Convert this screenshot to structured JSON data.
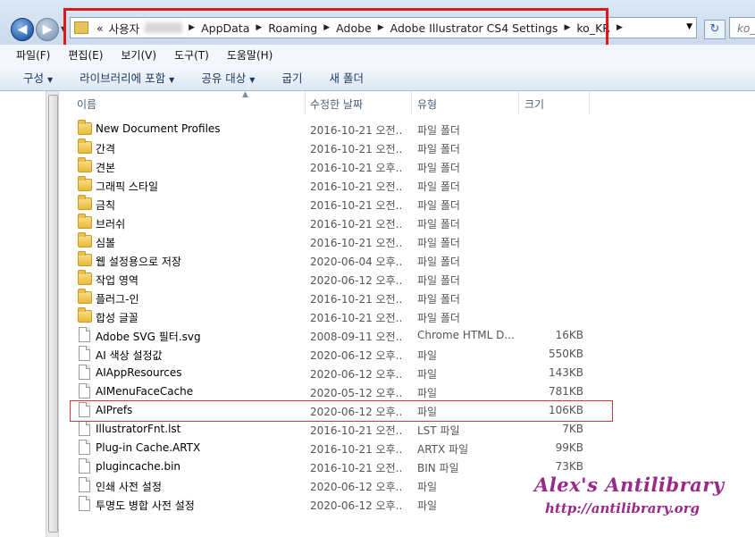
{
  "address_bar": {
    "overflow_marker": "«",
    "segments": [
      "사용자",
      "AppData",
      "Roaming",
      "Adobe",
      "Adobe Illustrator CS4 Settings",
      "ko_KR"
    ],
    "search_placeholder": "ko_"
  },
  "menu": [
    "파일(F)",
    "편집(E)",
    "보기(V)",
    "도구(T)",
    "도움말(H)"
  ],
  "commands": [
    {
      "label": "구성",
      "dropdown": true
    },
    {
      "label": "라이브러리에 포함",
      "dropdown": true
    },
    {
      "label": "공유 대상",
      "dropdown": true
    },
    {
      "label": "굽기",
      "dropdown": false
    },
    {
      "label": "새 폴더",
      "dropdown": false
    }
  ],
  "columns": {
    "name": "이름",
    "date": "수정한 날짜",
    "type": "유형",
    "size": "크기"
  },
  "files": [
    {
      "name": "New Document Profiles",
      "date": "2016-10-21 오전...",
      "type": "파일 폴더",
      "size": "",
      "kind": "folder"
    },
    {
      "name": "간격",
      "date": "2016-10-21 오전...",
      "type": "파일 폴더",
      "size": "",
      "kind": "folder"
    },
    {
      "name": "견본",
      "date": "2016-10-21 오후...",
      "type": "파일 폴더",
      "size": "",
      "kind": "folder"
    },
    {
      "name": "그래픽 스타일",
      "date": "2016-10-21 오전...",
      "type": "파일 폴더",
      "size": "",
      "kind": "folder"
    },
    {
      "name": "금칙",
      "date": "2016-10-21 오전...",
      "type": "파일 폴더",
      "size": "",
      "kind": "folder"
    },
    {
      "name": "브러쉬",
      "date": "2016-10-21 오전...",
      "type": "파일 폴더",
      "size": "",
      "kind": "folder"
    },
    {
      "name": "심볼",
      "date": "2016-10-21 오전...",
      "type": "파일 폴더",
      "size": "",
      "kind": "folder"
    },
    {
      "name": "웹 설정용으로 저장",
      "date": "2020-06-04 오후...",
      "type": "파일 폴더",
      "size": "",
      "kind": "folder"
    },
    {
      "name": "작업 영역",
      "date": "2020-06-12 오후...",
      "type": "파일 폴더",
      "size": "",
      "kind": "folder"
    },
    {
      "name": "플러그-인",
      "date": "2016-10-21 오전...",
      "type": "파일 폴더",
      "size": "",
      "kind": "folder"
    },
    {
      "name": "합성 글꼴",
      "date": "2016-10-21 오전...",
      "type": "파일 폴더",
      "size": "",
      "kind": "folder"
    },
    {
      "name": "Adobe SVG 필터.svg",
      "date": "2008-09-11 오전...",
      "type": "Chrome HTML D...",
      "size": "16KB",
      "kind": "file"
    },
    {
      "name": "AI 색상 설정값",
      "date": "2020-06-12 오후...",
      "type": "파일",
      "size": "550KB",
      "kind": "file"
    },
    {
      "name": "AIAppResources",
      "date": "2020-06-12 오후...",
      "type": "파일",
      "size": "143KB",
      "kind": "file"
    },
    {
      "name": "AIMenuFaceCache",
      "date": "2020-05-12 오후...",
      "type": "파일",
      "size": "781KB",
      "kind": "file"
    },
    {
      "name": "AIPrefs",
      "date": "2020-06-12 오후...",
      "type": "파일",
      "size": "106KB",
      "kind": "file"
    },
    {
      "name": "IllustratorFnt.lst",
      "date": "2016-10-21 오전...",
      "type": "LST 파일",
      "size": "7KB",
      "kind": "file"
    },
    {
      "name": "Plug-in Cache.ARTX",
      "date": "2016-10-21 오후...",
      "type": "ARTX 파일",
      "size": "99KB",
      "kind": "file"
    },
    {
      "name": "plugincache.bin",
      "date": "2016-10-21 오전...",
      "type": "BIN 파일",
      "size": "73KB",
      "kind": "file"
    },
    {
      "name": "인쇄 사전 설정",
      "date": "2020-06-12 오후...",
      "type": "파일",
      "size": "",
      "kind": "file"
    },
    {
      "name": "투명도 병합 사전 설정",
      "date": "2020-06-12 오후...",
      "type": "파일",
      "size": "",
      "kind": "file"
    }
  ],
  "watermark": {
    "title": "Alex's Antilibrary",
    "url": "http://antilibrary.org"
  },
  "colors": {
    "highlight": "#e01818",
    "watermark": "#9a2a8a",
    "folder": "#e8b93a"
  }
}
